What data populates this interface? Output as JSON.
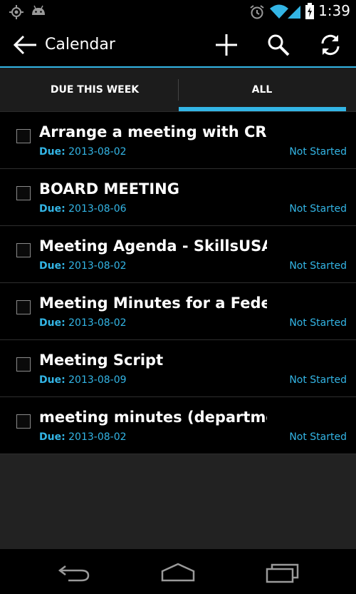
{
  "status_bar": {
    "time": "1:39",
    "icons": [
      "gps-icon",
      "android-icon",
      "alarm-icon",
      "wifi-icon",
      "signal-icon",
      "battery-charging-icon"
    ]
  },
  "action_bar": {
    "title": "Calendar",
    "icons": [
      "back-arrow-icon",
      "add-icon",
      "search-icon",
      "refresh-icon"
    ]
  },
  "tabs": [
    {
      "label": "DUE THIS WEEK",
      "selected": false
    },
    {
      "label": "ALL",
      "selected": true
    }
  ],
  "tasks": [
    {
      "title": "Arrange a meeting with CRM",
      "due_label": "Due:",
      "due_date": "2013-08-02",
      "status": "Not Started"
    },
    {
      "title": "BOARD MEETING",
      "due_label": "Due:",
      "due_date": "2013-08-06",
      "status": "Not Started"
    },
    {
      "title": "Meeting Agenda - SkillsUSA",
      "due_label": "Due:",
      "due_date": "2013-08-02",
      "status": "Not Started"
    },
    {
      "title": "Meeting Minutes for a Fede…",
      "due_label": "Due:",
      "due_date": "2013-08-02",
      "status": "Not Started"
    },
    {
      "title": "Meeting Script",
      "due_label": "Due:",
      "due_date": "2013-08-09",
      "status": "Not Started"
    },
    {
      "title": "meeting minutes (departme…",
      "due_label": "Due:",
      "due_date": "2013-08-02",
      "status": "Not Started"
    }
  ],
  "navbar": {
    "icons": [
      "nav-back-icon",
      "nav-home-icon",
      "nav-recents-icon"
    ]
  },
  "colors": {
    "accent": "#33b5e5",
    "background": "#000000",
    "empty_area": "#222222"
  }
}
